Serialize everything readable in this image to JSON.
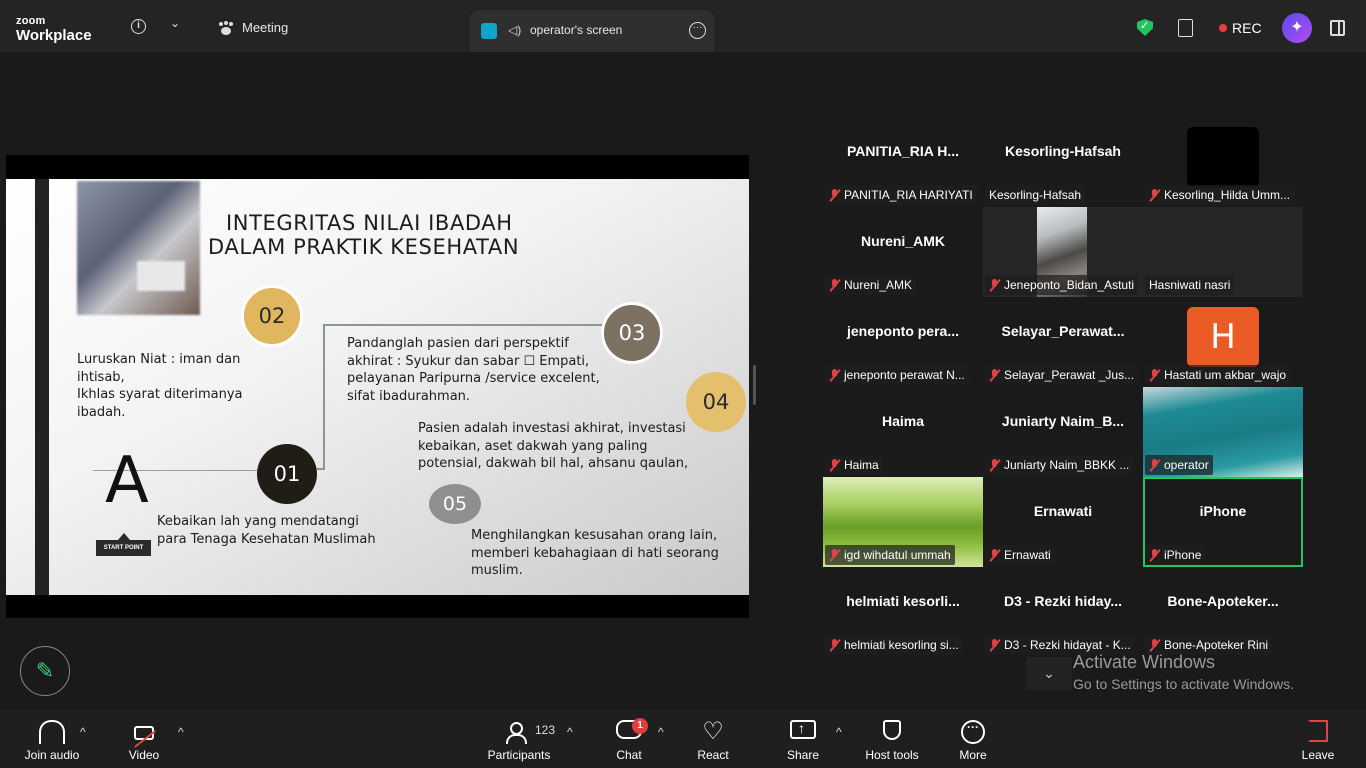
{
  "topbar": {
    "logo_line1": "zoom",
    "logo_line2": "Workplace",
    "meeting_tab": "Meeting",
    "share_tab": "operator's screen",
    "rec_label": "REC"
  },
  "slide": {
    "title_line1": "INTEGRITAS NILAI IBADAH",
    "title_line2": "DALAM PRAKTIK KESEHATAN",
    "circle_02": "02",
    "circle_03": "03",
    "circle_04": "04",
    "circle_01": "01",
    "circle_05": "05",
    "big_letter": "A",
    "start_point": "START POINT",
    "text_02": "Luruskan Niat : iman dan\nihtisab,\nIkhlas syarat diterimanya\nibadah.",
    "text_03": "Pandanglah pasien dari perspektif\nakhirat : Syukur dan sabar ☐ Empati,\npelayanan Paripurna /service excelent,\nsifat ibadurahman.",
    "text_04": "Pasien adalah investasi akhirat, investasi\nkebaikan, aset dakwah yang paling\npotensial, dakwah bil hal, ahsanu qaulan,",
    "text_01": "Kebaikan lah yang mendatangi\npara Tenaga Kesehatan Muslimah",
    "text_05": "Menghilangkan kesusahan orang lain,\nmemberi kebahagiaan di hati seorang\nmuslim."
  },
  "gallery": [
    {
      "name": "PANITIA_RIA H...",
      "label": "PANITIA_RIA HARIYATI",
      "muted": true
    },
    {
      "name": "Kesorling-Hafsah",
      "label": "Kesorling-Hafsah",
      "muted": false
    },
    {
      "name": "",
      "label": "Kesorling_Hilda Umm...",
      "muted": true
    },
    {
      "name": "Nureni_AMK",
      "label": "Nureni_AMK",
      "muted": true
    },
    {
      "name": "",
      "label": "Jeneponto_Bidan_Astuti",
      "muted": true
    },
    {
      "name": "",
      "label": "Hasniwati nasri",
      "muted": false
    },
    {
      "name": "jeneponto  pera...",
      "label": "jeneponto perawat N...",
      "muted": true
    },
    {
      "name": "Selayar_Perawat...",
      "label": "Selayar_Perawat _Jus...",
      "muted": true
    },
    {
      "name": "",
      "label": "Hastati um akbar_wajo",
      "muted": true,
      "avatar": "H"
    },
    {
      "name": "Haima",
      "label": "Haima",
      "muted": true
    },
    {
      "name": "Juniarty  Naim_B...",
      "label": "Juniarty Naim_BBKK ...",
      "muted": true
    },
    {
      "name": "",
      "label": "operator",
      "muted": true
    },
    {
      "name": "",
      "label": "igd wihdatul ummah",
      "muted": true
    },
    {
      "name": "Ernawati",
      "label": "Ernawati",
      "muted": true
    },
    {
      "name": "iPhone",
      "label": "iPhone",
      "muted": true
    },
    {
      "name": "helmiati  kesorli...",
      "label": "helmiati  kesorling si...",
      "muted": true
    },
    {
      "name": "D3 - Rezki hiday...",
      "label": "D3 - Rezki hidayat - K...",
      "muted": true
    },
    {
      "name": "Bone-Apoteker...",
      "label": "Bone-Apoteker Rini",
      "muted": true
    }
  ],
  "windows_notice": {
    "line1": "Activate Windows",
    "line2": "Go to Settings to activate Windows."
  },
  "toolbar": {
    "join_audio": "Join audio",
    "video": "Video",
    "participants": "Participants",
    "participants_count": "123",
    "chat": "Chat",
    "chat_badge": "1",
    "react": "React",
    "share": "Share",
    "host_tools": "Host tools",
    "more": "More",
    "leave": "Leave"
  }
}
